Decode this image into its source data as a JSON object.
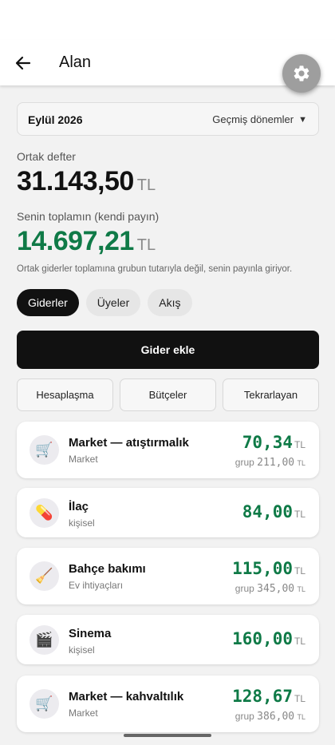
{
  "appbar": {
    "title": "Alan"
  },
  "icons": {
    "back": "arrow-left-icon",
    "settings": "gear-icon"
  },
  "period": {
    "label": "Eylül 2026",
    "selector": "Geçmiş dönemler",
    "caret": "▼"
  },
  "summary": {
    "shared_label": "Ortak defter",
    "shared_amount": "31.143,50",
    "shared_currency": "TL",
    "own_label": "Senin toplamın (kendi payın)",
    "own_amount": "14.697,21",
    "own_currency": "TL",
    "note": "Ortak giderler toplamına grubun tutarıyla değil, senin payınla giriyor."
  },
  "tabs": [
    {
      "label": "Giderler",
      "active": true
    },
    {
      "label": "Üyeler",
      "active": false
    },
    {
      "label": "Akış",
      "active": false
    }
  ],
  "actions": {
    "add_expense": "Gider ekle",
    "settle": "Hesaplaşma",
    "budgets": "Bütçeler",
    "recurring": "Tekrarlayan"
  },
  "colors": {
    "accent_green": "#0f7a47",
    "primary_dark": "#111111",
    "settings_fab": "#9e9e9e"
  },
  "expenses": [
    {
      "icon": "shopping-cart-icon",
      "emoji": "🛒",
      "title": "Market — atıştırmalık",
      "subtitle": "Market",
      "amount": "70,34",
      "currency": "TL",
      "group_label": "grup",
      "group_amount": "211,00",
      "group_currency": "TL"
    },
    {
      "icon": "pill-icon",
      "emoji": "💊",
      "title": "İlaç",
      "subtitle": "kişisel",
      "amount": "84,00",
      "currency": "TL"
    },
    {
      "icon": "broom-icon",
      "emoji": "🧹",
      "title": "Bahçe bakımı",
      "subtitle": "Ev ihtiyaçları",
      "amount": "115,00",
      "currency": "TL",
      "group_label": "grup",
      "group_amount": "345,00",
      "group_currency": "TL"
    },
    {
      "icon": "clapper-board-icon",
      "emoji": "🎬",
      "title": "Sinema",
      "subtitle": "kişisel",
      "amount": "160,00",
      "currency": "TL"
    },
    {
      "icon": "shopping-cart-icon",
      "emoji": "🛒",
      "title": "Market — kahvaltılık",
      "subtitle": "Market",
      "amount": "128,67",
      "currency": "TL",
      "group_label": "grup",
      "group_amount": "386,00",
      "group_currency": "TL"
    }
  ]
}
